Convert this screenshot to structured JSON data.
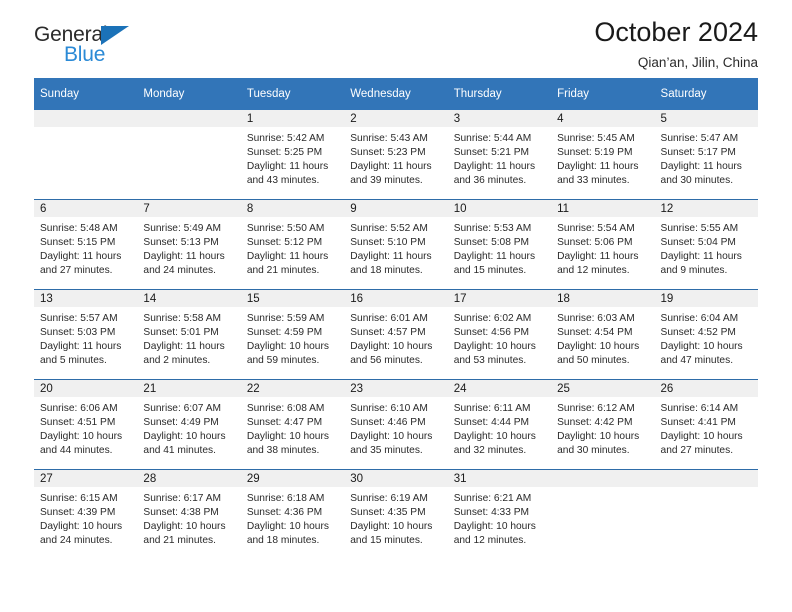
{
  "brand": {
    "name_top": "General",
    "name_bottom": "Blue",
    "triangle_icon": "brand-triangle-icon",
    "accent_color": "#1b72b8",
    "accent_color_light": "#2b8ad6"
  },
  "header": {
    "title": "October 2024",
    "subtitle": "Qian’an, Jilin, China"
  },
  "theme": {
    "header_blue": "#3275b8",
    "row_divider": "#2e6ca8",
    "daynum_band": "#f0f0f0",
    "page_background": "#ffffff"
  },
  "calendar": {
    "weekday_headers": [
      "Sunday",
      "Monday",
      "Tuesday",
      "Wednesday",
      "Thursday",
      "Friday",
      "Saturday"
    ],
    "weeks": [
      [
        {
          "day": "",
          "sunrise": "",
          "sunset": "",
          "daylight_1": "",
          "daylight_2": "",
          "empty": true
        },
        {
          "day": "",
          "sunrise": "",
          "sunset": "",
          "daylight_1": "",
          "daylight_2": "",
          "empty": true
        },
        {
          "day": "1",
          "sunrise": "Sunrise: 5:42 AM",
          "sunset": "Sunset: 5:25 PM",
          "daylight_1": "Daylight: 11 hours",
          "daylight_2": "and 43 minutes."
        },
        {
          "day": "2",
          "sunrise": "Sunrise: 5:43 AM",
          "sunset": "Sunset: 5:23 PM",
          "daylight_1": "Daylight: 11 hours",
          "daylight_2": "and 39 minutes."
        },
        {
          "day": "3",
          "sunrise": "Sunrise: 5:44 AM",
          "sunset": "Sunset: 5:21 PM",
          "daylight_1": "Daylight: 11 hours",
          "daylight_2": "and 36 minutes."
        },
        {
          "day": "4",
          "sunrise": "Sunrise: 5:45 AM",
          "sunset": "Sunset: 5:19 PM",
          "daylight_1": "Daylight: 11 hours",
          "daylight_2": "and 33 minutes."
        },
        {
          "day": "5",
          "sunrise": "Sunrise: 5:47 AM",
          "sunset": "Sunset: 5:17 PM",
          "daylight_1": "Daylight: 11 hours",
          "daylight_2": "and 30 minutes."
        }
      ],
      [
        {
          "day": "6",
          "sunrise": "Sunrise: 5:48 AM",
          "sunset": "Sunset: 5:15 PM",
          "daylight_1": "Daylight: 11 hours",
          "daylight_2": "and 27 minutes."
        },
        {
          "day": "7",
          "sunrise": "Sunrise: 5:49 AM",
          "sunset": "Sunset: 5:13 PM",
          "daylight_1": "Daylight: 11 hours",
          "daylight_2": "and 24 minutes."
        },
        {
          "day": "8",
          "sunrise": "Sunrise: 5:50 AM",
          "sunset": "Sunset: 5:12 PM",
          "daylight_1": "Daylight: 11 hours",
          "daylight_2": "and 21 minutes."
        },
        {
          "day": "9",
          "sunrise": "Sunrise: 5:52 AM",
          "sunset": "Sunset: 5:10 PM",
          "daylight_1": "Daylight: 11 hours",
          "daylight_2": "and 18 minutes."
        },
        {
          "day": "10",
          "sunrise": "Sunrise: 5:53 AM",
          "sunset": "Sunset: 5:08 PM",
          "daylight_1": "Daylight: 11 hours",
          "daylight_2": "and 15 minutes."
        },
        {
          "day": "11",
          "sunrise": "Sunrise: 5:54 AM",
          "sunset": "Sunset: 5:06 PM",
          "daylight_1": "Daylight: 11 hours",
          "daylight_2": "and 12 minutes."
        },
        {
          "day": "12",
          "sunrise": "Sunrise: 5:55 AM",
          "sunset": "Sunset: 5:04 PM",
          "daylight_1": "Daylight: 11 hours",
          "daylight_2": "and 9 minutes."
        }
      ],
      [
        {
          "day": "13",
          "sunrise": "Sunrise: 5:57 AM",
          "sunset": "Sunset: 5:03 PM",
          "daylight_1": "Daylight: 11 hours",
          "daylight_2": "and 5 minutes."
        },
        {
          "day": "14",
          "sunrise": "Sunrise: 5:58 AM",
          "sunset": "Sunset: 5:01 PM",
          "daylight_1": "Daylight: 11 hours",
          "daylight_2": "and 2 minutes."
        },
        {
          "day": "15",
          "sunrise": "Sunrise: 5:59 AM",
          "sunset": "Sunset: 4:59 PM",
          "daylight_1": "Daylight: 10 hours",
          "daylight_2": "and 59 minutes."
        },
        {
          "day": "16",
          "sunrise": "Sunrise: 6:01 AM",
          "sunset": "Sunset: 4:57 PM",
          "daylight_1": "Daylight: 10 hours",
          "daylight_2": "and 56 minutes."
        },
        {
          "day": "17",
          "sunrise": "Sunrise: 6:02 AM",
          "sunset": "Sunset: 4:56 PM",
          "daylight_1": "Daylight: 10 hours",
          "daylight_2": "and 53 minutes."
        },
        {
          "day": "18",
          "sunrise": "Sunrise: 6:03 AM",
          "sunset": "Sunset: 4:54 PM",
          "daylight_1": "Daylight: 10 hours",
          "daylight_2": "and 50 minutes."
        },
        {
          "day": "19",
          "sunrise": "Sunrise: 6:04 AM",
          "sunset": "Sunset: 4:52 PM",
          "daylight_1": "Daylight: 10 hours",
          "daylight_2": "and 47 minutes."
        }
      ],
      [
        {
          "day": "20",
          "sunrise": "Sunrise: 6:06 AM",
          "sunset": "Sunset: 4:51 PM",
          "daylight_1": "Daylight: 10 hours",
          "daylight_2": "and 44 minutes."
        },
        {
          "day": "21",
          "sunrise": "Sunrise: 6:07 AM",
          "sunset": "Sunset: 4:49 PM",
          "daylight_1": "Daylight: 10 hours",
          "daylight_2": "and 41 minutes."
        },
        {
          "day": "22",
          "sunrise": "Sunrise: 6:08 AM",
          "sunset": "Sunset: 4:47 PM",
          "daylight_1": "Daylight: 10 hours",
          "daylight_2": "and 38 minutes."
        },
        {
          "day": "23",
          "sunrise": "Sunrise: 6:10 AM",
          "sunset": "Sunset: 4:46 PM",
          "daylight_1": "Daylight: 10 hours",
          "daylight_2": "and 35 minutes."
        },
        {
          "day": "24",
          "sunrise": "Sunrise: 6:11 AM",
          "sunset": "Sunset: 4:44 PM",
          "daylight_1": "Daylight: 10 hours",
          "daylight_2": "and 32 minutes."
        },
        {
          "day": "25",
          "sunrise": "Sunrise: 6:12 AM",
          "sunset": "Sunset: 4:42 PM",
          "daylight_1": "Daylight: 10 hours",
          "daylight_2": "and 30 minutes."
        },
        {
          "day": "26",
          "sunrise": "Sunrise: 6:14 AM",
          "sunset": "Sunset: 4:41 PM",
          "daylight_1": "Daylight: 10 hours",
          "daylight_2": "and 27 minutes."
        }
      ],
      [
        {
          "day": "27",
          "sunrise": "Sunrise: 6:15 AM",
          "sunset": "Sunset: 4:39 PM",
          "daylight_1": "Daylight: 10 hours",
          "daylight_2": "and 24 minutes."
        },
        {
          "day": "28",
          "sunrise": "Sunrise: 6:17 AM",
          "sunset": "Sunset: 4:38 PM",
          "daylight_1": "Daylight: 10 hours",
          "daylight_2": "and 21 minutes."
        },
        {
          "day": "29",
          "sunrise": "Sunrise: 6:18 AM",
          "sunset": "Sunset: 4:36 PM",
          "daylight_1": "Daylight: 10 hours",
          "daylight_2": "and 18 minutes."
        },
        {
          "day": "30",
          "sunrise": "Sunrise: 6:19 AM",
          "sunset": "Sunset: 4:35 PM",
          "daylight_1": "Daylight: 10 hours",
          "daylight_2": "and 15 minutes."
        },
        {
          "day": "31",
          "sunrise": "Sunrise: 6:21 AM",
          "sunset": "Sunset: 4:33 PM",
          "daylight_1": "Daylight: 10 hours",
          "daylight_2": "and 12 minutes."
        },
        {
          "day": "",
          "sunrise": "",
          "sunset": "",
          "daylight_1": "",
          "daylight_2": "",
          "empty": true
        },
        {
          "day": "",
          "sunrise": "",
          "sunset": "",
          "daylight_1": "",
          "daylight_2": "",
          "empty": true
        }
      ]
    ]
  }
}
